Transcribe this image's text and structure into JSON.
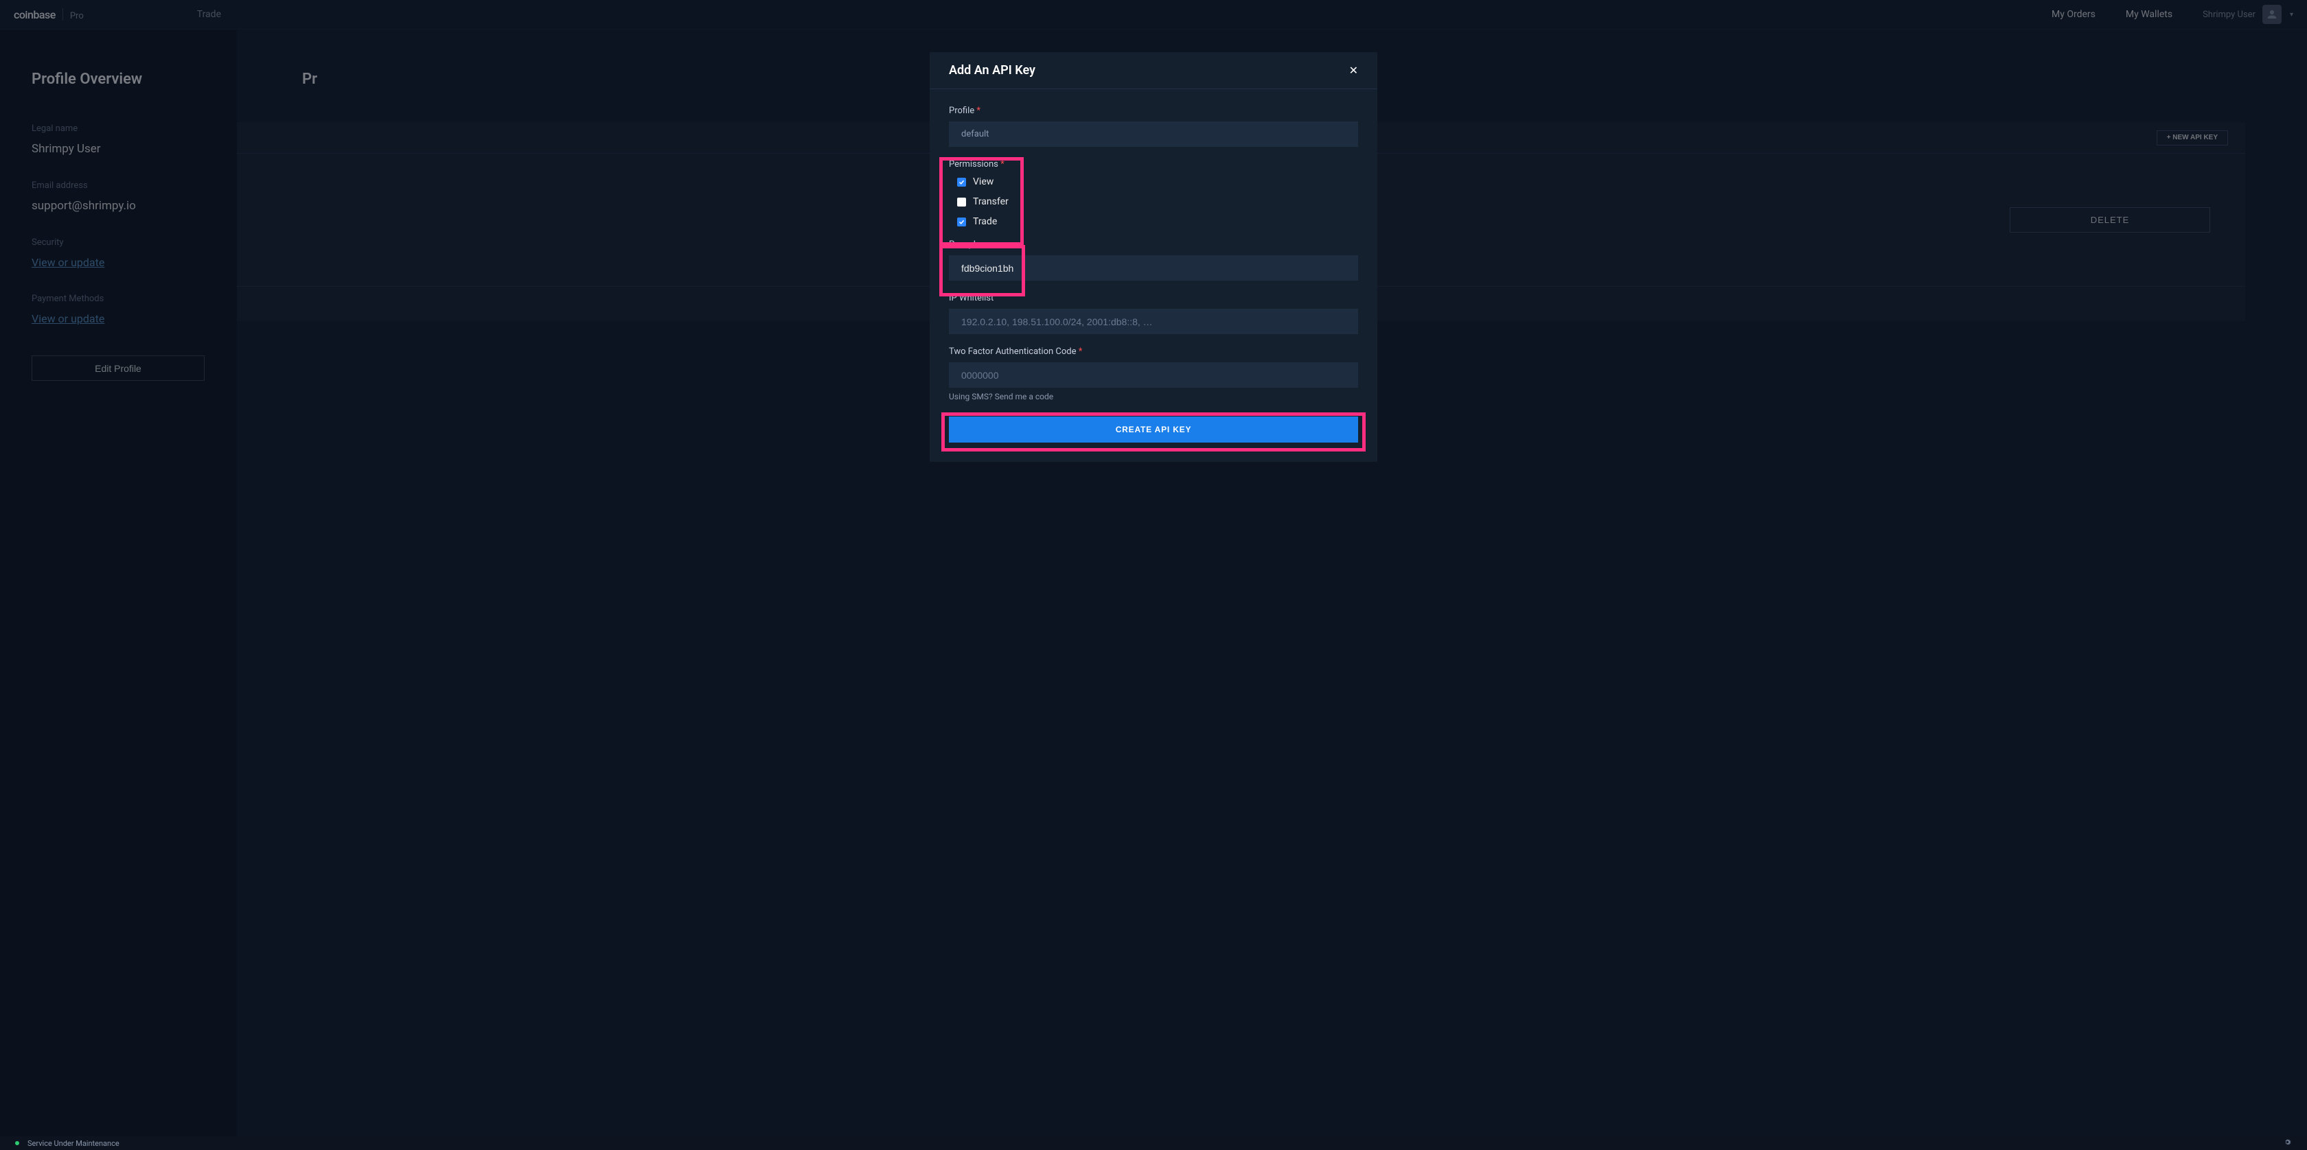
{
  "header": {
    "logo_main": "coinbase",
    "logo_sub": "Pro",
    "nav_trade": "Trade",
    "nav_orders": "My Orders",
    "nav_wallets": "My Wallets",
    "username": "Shrimpy User"
  },
  "sidebar": {
    "title": "Profile Overview",
    "legal_name_label": "Legal name",
    "legal_name_value": "Shrimpy User",
    "email_label": "Email address",
    "email_value": "support@shrimpy.io",
    "security_label": "Security",
    "security_link": "View or update",
    "payment_label": "Payment Methods",
    "payment_link": "View or update",
    "edit_button": "Edit Profile"
  },
  "content": {
    "heading_partial": "Pr",
    "new_api_key_button": "+ NEW API KEY",
    "delete_button": "DELETE"
  },
  "modal": {
    "title": "Add An API Key",
    "profile_label": "Profile",
    "profile_value": "default",
    "permissions_label": "Permissions",
    "permissions": [
      {
        "label": "View",
        "checked": true
      },
      {
        "label": "Transfer",
        "checked": false
      },
      {
        "label": "Trade",
        "checked": true
      }
    ],
    "passphrase_label": "Passphrase",
    "passphrase_value": "fdb9cion1bh",
    "ipwhitelist_label": "IP Whitelist",
    "ipwhitelist_placeholder": "192.0.2.10, 198.51.100.0/24, 2001:db8::8, …",
    "tfa_label": "Two Factor Authentication Code",
    "tfa_placeholder": "0000000",
    "sms_link": "Using SMS? Send me a code",
    "create_button": "CREATE API KEY"
  },
  "statusbar": {
    "text": "Service Under Maintenance"
  }
}
